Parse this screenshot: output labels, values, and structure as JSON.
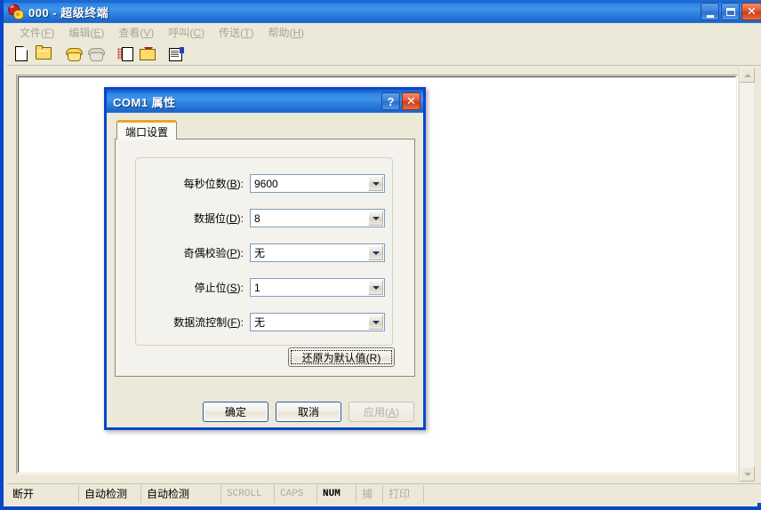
{
  "window": {
    "title": "000 - 超级终端",
    "icon": "phone-icon",
    "controls": {
      "minimize": "_",
      "maximize": "□",
      "close": "✕"
    }
  },
  "menubar": {
    "items": [
      {
        "label": "文件",
        "mnemonic": "F",
        "name": "menu-file"
      },
      {
        "label": "编辑",
        "mnemonic": "E",
        "name": "menu-edit"
      },
      {
        "label": "查看",
        "mnemonic": "V",
        "name": "menu-view"
      },
      {
        "label": "呼叫",
        "mnemonic": "C",
        "name": "menu-call"
      },
      {
        "label": "传送",
        "mnemonic": "T",
        "name": "menu-transfer"
      },
      {
        "label": "帮助",
        "mnemonic": "H",
        "name": "menu-help"
      }
    ]
  },
  "toolbar": {
    "buttons": [
      {
        "icon": "new-document-icon",
        "enabled": true
      },
      {
        "icon": "open-folder-icon",
        "enabled": true
      },
      {
        "icon": "call-phone-icon",
        "enabled": true
      },
      {
        "icon": "hangup-phone-icon",
        "enabled": false
      },
      {
        "icon": "send-file-icon",
        "enabled": true
      },
      {
        "icon": "receive-file-icon",
        "enabled": true
      },
      {
        "icon": "properties-icon",
        "enabled": true
      }
    ]
  },
  "dialog": {
    "title": "COM1 属性",
    "help_button": "?",
    "close_button": "✕",
    "tab": {
      "label": "端口设置"
    },
    "fields": [
      {
        "label": "每秒位数",
        "mnemonic": "B",
        "value": "9600",
        "name": "bits-per-second"
      },
      {
        "label": "数据位",
        "mnemonic": "D",
        "value": "8",
        "name": "data-bits"
      },
      {
        "label": "奇偶校验",
        "mnemonic": "P",
        "value": "无",
        "name": "parity"
      },
      {
        "label": "停止位",
        "mnemonic": "S",
        "value": "1",
        "name": "stop-bits"
      },
      {
        "label": "数据流控制",
        "mnemonic": "F",
        "value": "无",
        "name": "flow-control"
      }
    ],
    "restore_defaults": {
      "label": "还原为默认值",
      "mnemonic": "R"
    },
    "footer": {
      "ok": {
        "label": "确定"
      },
      "cancel": {
        "label": "取消"
      },
      "apply": {
        "label": "应用",
        "mnemonic": "A",
        "enabled": false
      }
    }
  },
  "statusbar": {
    "cells": [
      {
        "text": "断开",
        "dim": false,
        "name": "status-connection"
      },
      {
        "text": "自动检测",
        "dim": false,
        "name": "status-autodetect-1"
      },
      {
        "text": "自动检测",
        "dim": false,
        "name": "status-autodetect-2"
      },
      {
        "text": "SCROLL",
        "dim": true,
        "name": "status-scroll"
      },
      {
        "text": "CAPS",
        "dim": true,
        "name": "status-caps"
      },
      {
        "text": "NUM",
        "dim": false,
        "name": "status-num"
      },
      {
        "text": "捕",
        "dim": true,
        "name": "status-capture"
      },
      {
        "text": "打印",
        "dim": true,
        "name": "status-print"
      }
    ]
  },
  "colors": {
    "titlebar_blue": "#2d84e4",
    "frame_blue": "#0a46c8",
    "window_face": "#ece9d8",
    "tab_accent": "#f0a32a",
    "terminal_bg": "#ffffff"
  }
}
